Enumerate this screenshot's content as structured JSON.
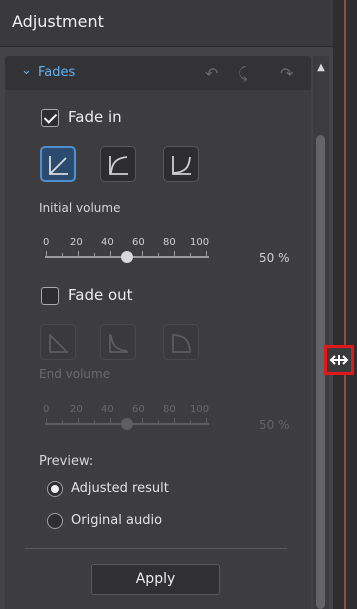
{
  "header": {
    "title": "Adjustment"
  },
  "section": {
    "title": "Fades",
    "chevron_icon": "chevron-down-icon",
    "toolbar_icons": [
      "undo-icon",
      "redo-icon",
      "reset-icon"
    ],
    "accent": "#5fb3f0"
  },
  "fade_in": {
    "label": "Fade in",
    "checked": true,
    "curves": [
      "linear-curve",
      "logarithmic-curve",
      "exponential-curve"
    ],
    "selected_curve": 0,
    "volume_label": "Initial volume",
    "scale": [
      "0",
      "20",
      "40",
      "60",
      "80",
      "100"
    ],
    "value_text": "50 %",
    "value": 50,
    "enabled": true
  },
  "fade_out": {
    "label": "Fade out",
    "checked": false,
    "curves": [
      "linear-out-curve",
      "logarithmic-out-curve",
      "exponential-out-curve"
    ],
    "volume_label": "End volume",
    "scale": [
      "0",
      "20",
      "40",
      "60",
      "80",
      "100"
    ],
    "value_text": "50 %",
    "value": 50,
    "enabled": false
  },
  "preview": {
    "label": "Preview:",
    "options": [
      "Adjusted result",
      "Original audio"
    ],
    "selected": 0
  },
  "apply": {
    "label": "Apply"
  },
  "colors": {
    "panel": "#444446",
    "selection_border": "#4f8fd0",
    "highlight": "#e01818"
  }
}
